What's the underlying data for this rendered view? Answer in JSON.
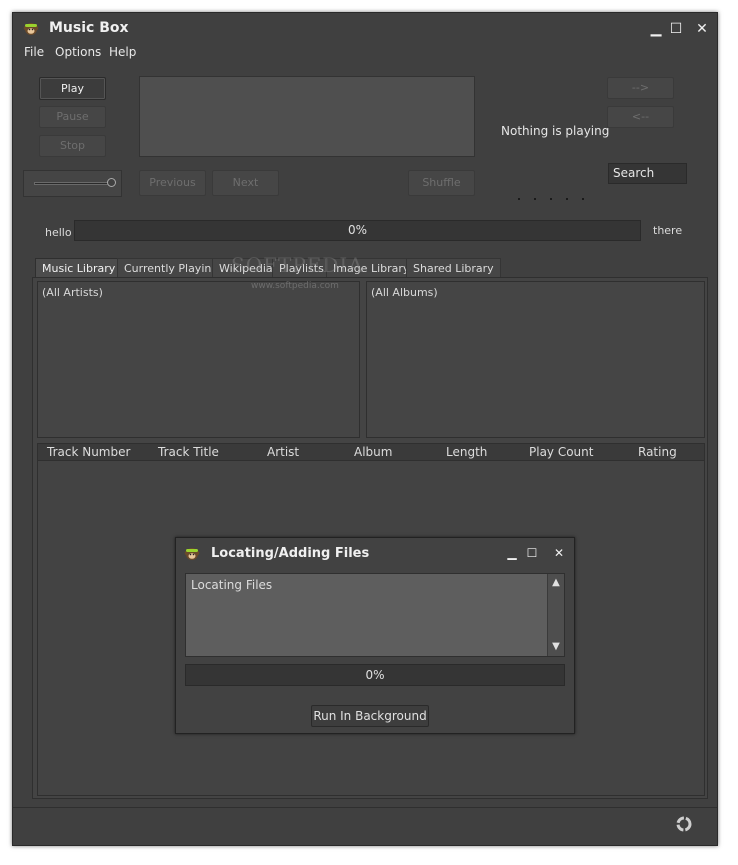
{
  "window": {
    "title": "Music Box"
  },
  "menu": [
    {
      "label": "File"
    },
    {
      "label": "Options"
    },
    {
      "label": "Help"
    }
  ],
  "controls": {
    "play": "Play",
    "pause": "Pause",
    "stop": "Stop",
    "previous": "Previous",
    "next": "Next",
    "shuffle": "Shuffle",
    "forward": "-->",
    "back": "<--",
    "search": "Search"
  },
  "now_playing": "Nothing is playing",
  "progress": {
    "left_label": "hello",
    "right_label": "there",
    "text": "0%",
    "value": 0
  },
  "tabs": [
    {
      "label": "Music Library",
      "active": true
    },
    {
      "label": "Currently Playing"
    },
    {
      "label": "Wikipedia"
    },
    {
      "label": "Playlists"
    },
    {
      "label": "Image Library"
    },
    {
      "label": "Shared Library"
    }
  ],
  "library": {
    "artists": "(All Artists)",
    "albums": "(All Albums)",
    "columns": [
      "Track Number",
      "Track Title",
      "Artist",
      "Album",
      "Length",
      "Play Count",
      "Rating"
    ]
  },
  "dialog": {
    "title": "Locating/Adding Files",
    "message": "Locating Files",
    "progress_text": "0%",
    "progress_value": 0,
    "button": "Run In Background"
  },
  "watermark": {
    "brand": "SOFTPEDIA",
    "url": "www.softpedia.com"
  }
}
